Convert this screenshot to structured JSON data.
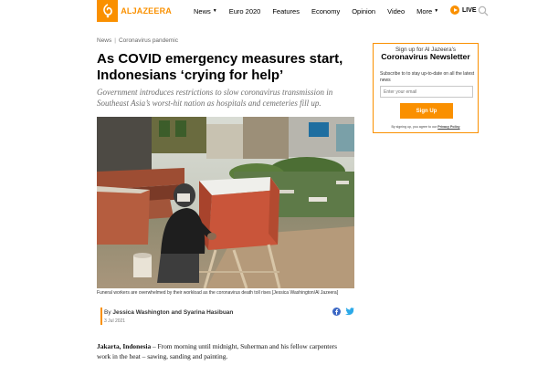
{
  "header": {
    "logo_text": "ALJAZEERA",
    "brand_color": "#fa9000",
    "nav": [
      {
        "label": "News",
        "has_dropdown": true
      },
      {
        "label": "Euro 2020",
        "has_dropdown": false
      },
      {
        "label": "Features",
        "has_dropdown": false
      },
      {
        "label": "Economy",
        "has_dropdown": false
      },
      {
        "label": "Opinion",
        "has_dropdown": false
      },
      {
        "label": "Video",
        "has_dropdown": false
      },
      {
        "label": "More",
        "has_dropdown": true
      }
    ],
    "live_label": "LIVE",
    "search_icon": "search-icon"
  },
  "article": {
    "breadcrumb": [
      "News",
      "Coronavirus pandemic"
    ],
    "headline": "As COVID emergency measures start, Indonesians ‘crying for help’",
    "standfirst": "Government introduces restrictions to slow coronavirus transmission in Southeast Asia’s worst-hit nation as hospitals and cemeteries fill up.",
    "caption": "Funeral workers are overwhelmed by their workload as the coronavirus death toll rises [Jessica Washington/Al Jazeera]",
    "byline_prefix": "By",
    "authors": "Jessica Washington and Syarina Hasibuan",
    "date": "3 Jul 2021",
    "share_icons": [
      "facebook-icon",
      "twitter-icon"
    ],
    "body_dateline": "Jakarta, Indonesia",
    "body_text": " – From morning until midnight, Suherman and his fellow carpenters work in the heat – sawing, sanding and painting."
  },
  "newsletter": {
    "kicker": "Sign up for Al Jazeera’s",
    "title": "Coronavirus Newsletter",
    "description": "Subscribe to to stay up-to-date on all the latest news",
    "email_placeholder": "Enter your email",
    "button_label": "Sign Up",
    "note_prefix": "By signing up, you agree to our",
    "note_link": "Privacy Policy"
  }
}
